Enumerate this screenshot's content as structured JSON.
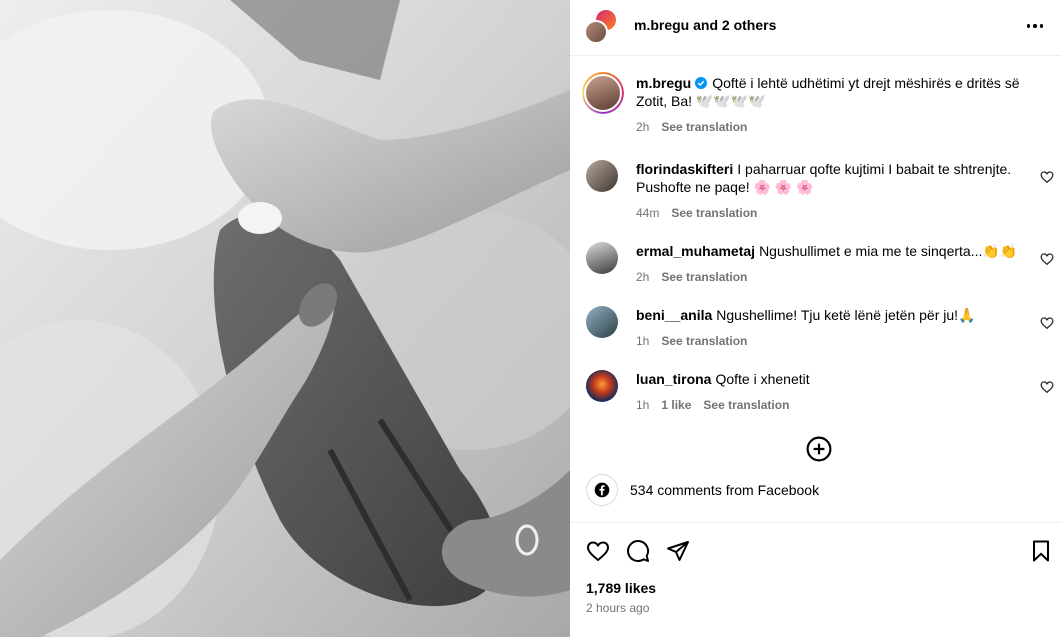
{
  "header": {
    "username": "m.bregu",
    "others_text": "and 2 others"
  },
  "caption": {
    "username": "m.bregu",
    "text": "Qoftë i lehtë udhëtimi yt drejt mëshirës e dritës së Zotit, Ba! 🕊️🕊️🕊️🕊️",
    "time": "2h",
    "translation": "See translation"
  },
  "comments": [
    {
      "username": "florindaskifteri",
      "text": "I paharruar qofte kujtimi I babait te shtrenjte. Pushofte ne paqe! 🌸 🌸 🌸",
      "time": "44m",
      "likes": "",
      "translation": "See translation"
    },
    {
      "username": "ermal_muhametaj",
      "text": "Ngushullimet e mia me te sinqerta...👏👏",
      "time": "2h",
      "likes": "",
      "translation": "See translation"
    },
    {
      "username": "beni__anila",
      "text": "Ngushellime! Tju ketë lënë jetën për ju!🙏",
      "time": "1h",
      "likes": "",
      "translation": "See translation"
    },
    {
      "username": "luan_tirona",
      "text": "Qofte i xhenetit",
      "time": "1h",
      "likes": "1 like",
      "translation": "See translation"
    }
  ],
  "facebook": {
    "text": "534 comments from Facebook"
  },
  "footer": {
    "likes": "1,789 likes",
    "posted": "2 hours ago"
  },
  "icons": {
    "more": "more-horizontal-icon",
    "heart": "heart-outline-icon",
    "comment": "comment-bubble-icon",
    "share": "paper-plane-icon",
    "save": "bookmark-icon",
    "load_more": "plus-circle-icon",
    "facebook": "facebook-icon",
    "verified": "verified-badge-icon"
  },
  "colors": {
    "verified": "#0095f6",
    "secondary_text": "#737373"
  }
}
